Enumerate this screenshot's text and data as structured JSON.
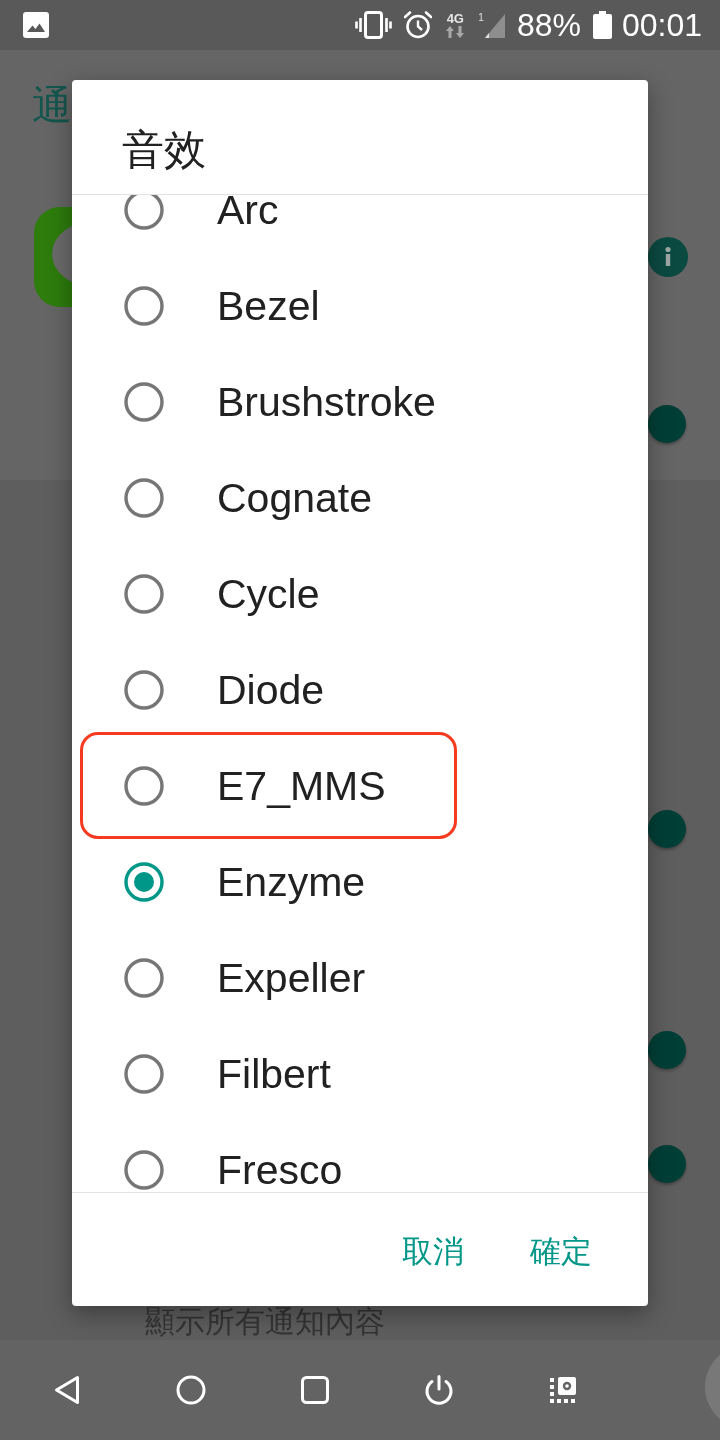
{
  "status_bar": {
    "network_type": "4G",
    "sim_slot": "1",
    "battery": "88%",
    "time": "00:01"
  },
  "background_screen": {
    "title": "通",
    "switches": [
      {
        "on": true
      },
      {
        "on": true
      },
      {
        "on": true
      },
      {
        "on": true
      }
    ],
    "caption": "顯示所有通知內容"
  },
  "dialog": {
    "title": "音效",
    "options": [
      {
        "label": "Arc",
        "selected": false,
        "annotated": false
      },
      {
        "label": "Bezel",
        "selected": false,
        "annotated": false
      },
      {
        "label": "Brushstroke",
        "selected": false,
        "annotated": false
      },
      {
        "label": "Cognate",
        "selected": false,
        "annotated": false
      },
      {
        "label": "Cycle",
        "selected": false,
        "annotated": false
      },
      {
        "label": "Diode",
        "selected": false,
        "annotated": false
      },
      {
        "label": "E7_MMS",
        "selected": false,
        "annotated": true
      },
      {
        "label": "Enzyme",
        "selected": true,
        "annotated": false
      },
      {
        "label": "Expeller",
        "selected": false,
        "annotated": false
      },
      {
        "label": "Filbert",
        "selected": false,
        "annotated": false
      },
      {
        "label": "Fresco",
        "selected": false,
        "annotated": false
      }
    ],
    "buttons": [
      "取消",
      "確定"
    ]
  }
}
